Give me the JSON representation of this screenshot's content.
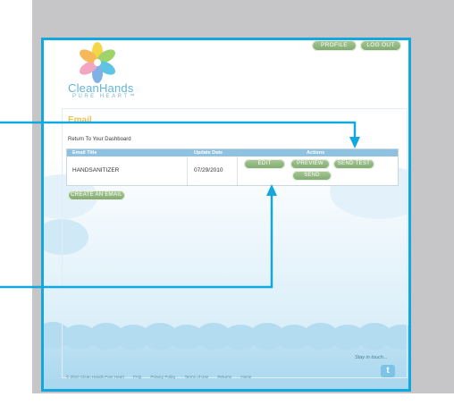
{
  "header": {
    "profile_label": "PROFILE",
    "logout_label": "LOG OUT"
  },
  "logo": {
    "name": "CleanHands",
    "tagline": "PURE HEART™"
  },
  "page": {
    "title": "Email",
    "return_link": "Return To Your Dashboard"
  },
  "table": {
    "headers": [
      "Email Title",
      "Update Date",
      "Actions"
    ],
    "rows": [
      {
        "title": "HANDSANITIZER",
        "date": "07/29/2010",
        "actions": [
          "EDIT",
          "PREVIEW",
          "SEND TEST",
          "SEND"
        ]
      }
    ]
  },
  "create_button_label": "CREATE AN EMAIL",
  "footer": {
    "copyright": "© 2010 Clean Hands Pure Heart",
    "links": [
      "FAQ",
      "Privacy Policy",
      "Terms of Use",
      "Returns",
      "Home"
    ],
    "stay_in_touch": "Stay in touch...",
    "twitter_glyph": "t"
  },
  "colors": {
    "annotation_blue": "#12a7df",
    "button_green": "#8db37c",
    "title_yellow": "#e8c45a",
    "table_header_blue": "#8fc2e0"
  }
}
